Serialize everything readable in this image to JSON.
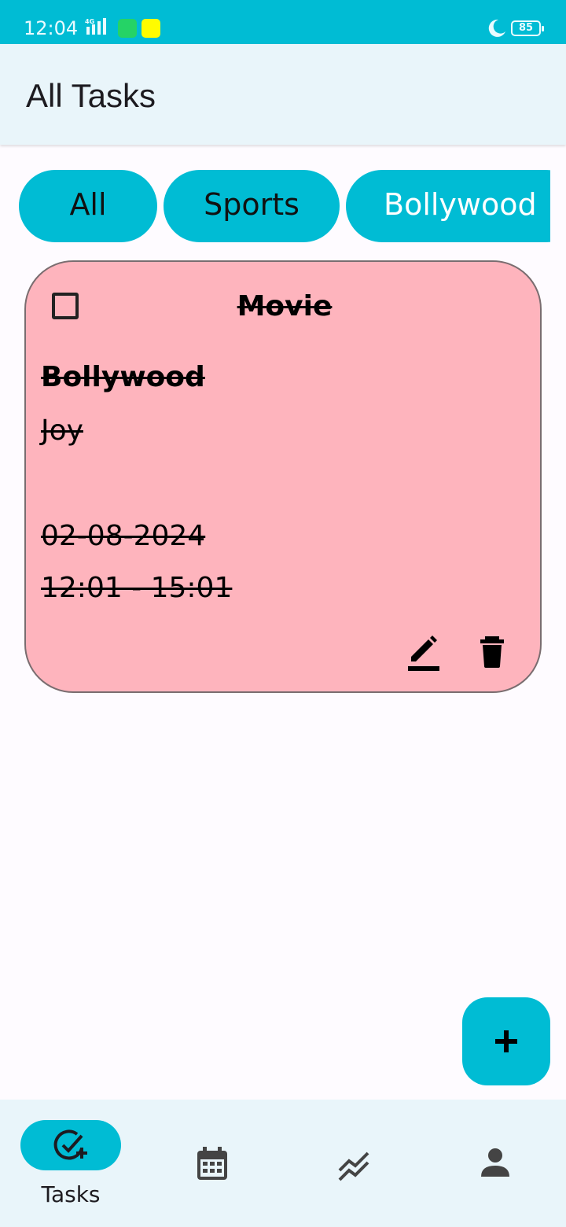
{
  "status_bar": {
    "time": "12:04",
    "network": "4G",
    "battery": "85",
    "notification_icons": [
      "whatsapp-icon",
      "snapchat-icon"
    ]
  },
  "app_bar": {
    "title": "All Tasks"
  },
  "filters": {
    "chips": [
      "All",
      "Sports",
      "Bollywood"
    ]
  },
  "task": {
    "title": "Movie",
    "category": "Bollywood",
    "description": "Joy",
    "date": "02-08-2024",
    "time_range": "12:01 - 15:01",
    "completed": false,
    "card_color": "#feb4bd"
  },
  "fab": {
    "icon": "plus-icon"
  },
  "bottom_nav": {
    "items": [
      {
        "label": "Tasks",
        "icon": "task-add-icon",
        "active": true
      },
      {
        "label": "",
        "icon": "calendar-icon",
        "active": false
      },
      {
        "label": "",
        "icon": "trending-icon",
        "active": false
      },
      {
        "label": "",
        "icon": "person-icon",
        "active": false
      }
    ]
  },
  "colors": {
    "accent": "#00bcd4",
    "surface": "#e9f5fa",
    "background": "#fefbff"
  }
}
